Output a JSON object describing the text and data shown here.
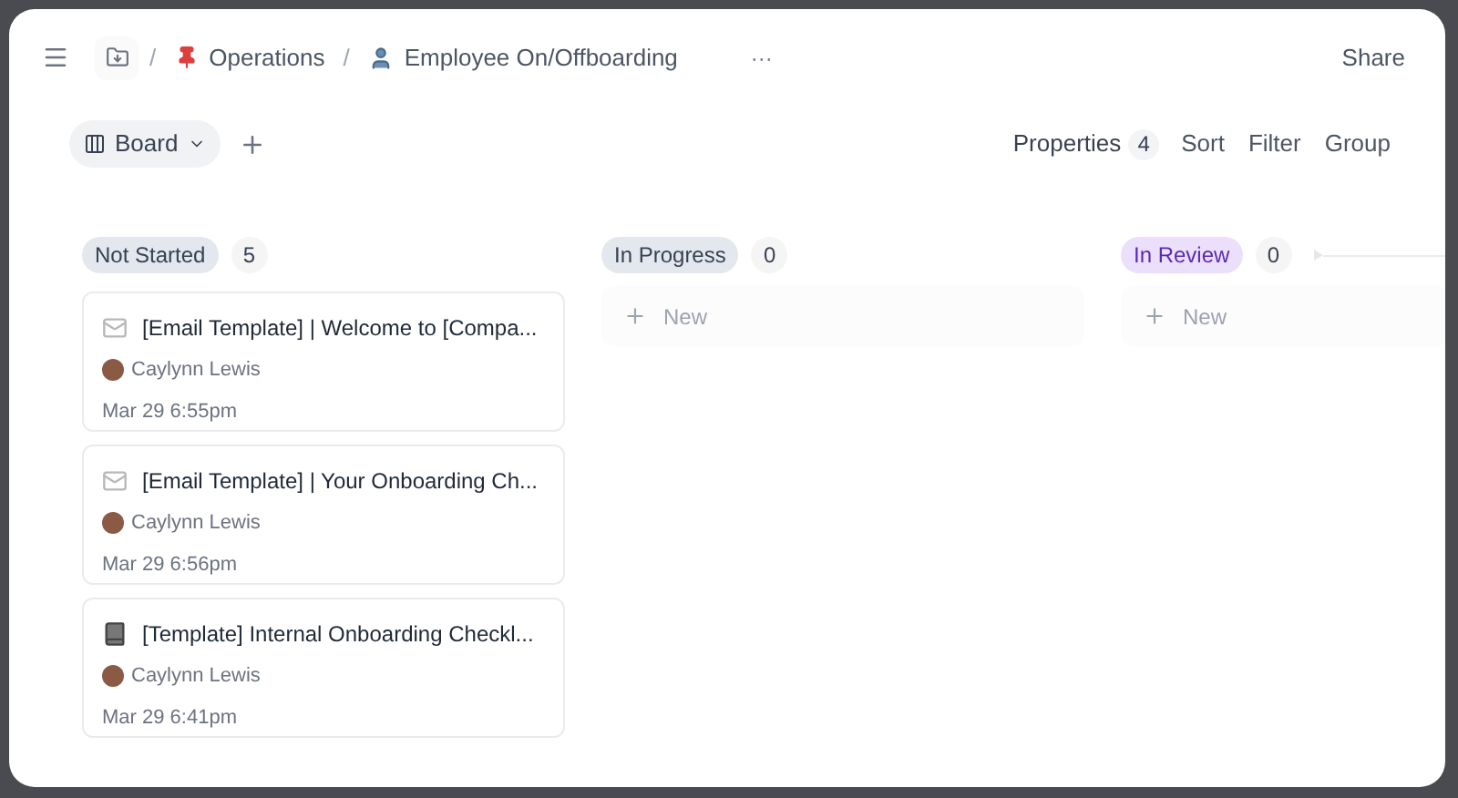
{
  "breadcrumb": {
    "separator": "/",
    "items": [
      {
        "label": "Operations",
        "kind": "pin"
      },
      {
        "label": "Employee On/Offboarding",
        "kind": "person"
      }
    ],
    "more": "···"
  },
  "share": "Share",
  "view": {
    "label": "Board"
  },
  "toolbar": {
    "properties": "Properties",
    "properties_count": "4",
    "sort": "Sort",
    "filter": "Filter",
    "group": "Group"
  },
  "columns": [
    {
      "name": "Not Started",
      "count": "5",
      "color": "#e3e8ef",
      "cards": [
        {
          "kind": "email",
          "title": "[Email Template] | Welcome to [Compa...",
          "author": "Caylynn Lewis",
          "date": "Mar 29 6:55pm"
        },
        {
          "kind": "email",
          "title": "[Email Template] | Your Onboarding Ch...",
          "author": "Caylynn Lewis",
          "date": "Mar 29 6:56pm"
        },
        {
          "kind": "book",
          "title": "[Template] Internal Onboarding Checkl...",
          "author": "Caylynn Lewis",
          "date": "Mar 29 6:41pm"
        }
      ]
    },
    {
      "name": "In Progress",
      "count": "0",
      "color": "#e3e8ef",
      "new_label": "New"
    },
    {
      "name": "In Review",
      "count": "0",
      "color": "#ebdffb",
      "new_label": "New"
    }
  ]
}
